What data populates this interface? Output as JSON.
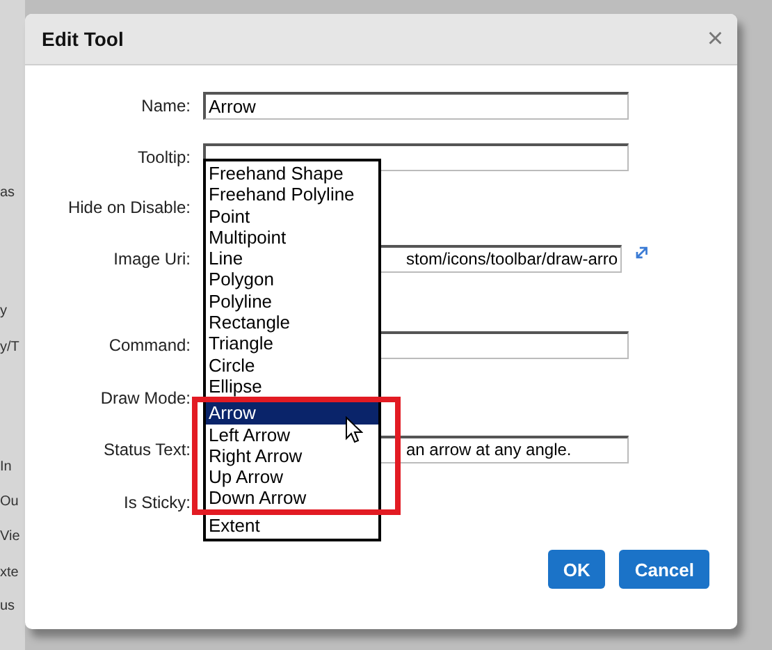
{
  "background": {
    "sidebar_fragments": [
      "as",
      "y",
      "y/T",
      "In",
      "Ou",
      "Vie",
      "xte",
      "us"
    ]
  },
  "dialog": {
    "title": "Edit Tool",
    "close": "×",
    "fields": [
      {
        "label": "Name:",
        "kind": "text",
        "value": "Arrow"
      },
      {
        "label": "Tooltip:",
        "kind": "text"
      },
      {
        "label": "Hide on Disable:",
        "kind": "covered"
      },
      {
        "label": "Image Uri:",
        "kind": "clipped_text",
        "value": "stom/icons/toolbar/draw-arro",
        "link_icon": true
      },
      {
        "label": "Command:",
        "kind": "text"
      },
      {
        "label": "Draw Mode:",
        "kind": "covered"
      },
      {
        "label": "Status Text:",
        "kind": "clipped_text",
        "value": "an arrow at any angle."
      },
      {
        "label": "Is Sticky:",
        "kind": "covered"
      }
    ],
    "dropdown": {
      "options": [
        {
          "label": "Freehand Shape",
          "selected": false,
          "highlighted": false
        },
        {
          "label": "Freehand Polyline",
          "selected": false,
          "highlighted": false
        },
        {
          "label": "Point",
          "selected": false,
          "highlighted": false
        },
        {
          "label": "Multipoint",
          "selected": false,
          "highlighted": false
        },
        {
          "label": "Line",
          "selected": false,
          "highlighted": false
        },
        {
          "label": "Polygon",
          "selected": false,
          "highlighted": false
        },
        {
          "label": "Polyline",
          "selected": false,
          "highlighted": false
        },
        {
          "label": "Rectangle",
          "selected": false,
          "highlighted": false
        },
        {
          "label": "Triangle",
          "selected": false,
          "highlighted": false
        },
        {
          "label": "Circle",
          "selected": false,
          "highlighted": false
        },
        {
          "label": "Ellipse",
          "selected": false,
          "highlighted": false
        },
        {
          "label": "Arrow",
          "selected": true,
          "highlighted": true
        },
        {
          "label": "Left Arrow",
          "selected": false,
          "highlighted": true
        },
        {
          "label": "Right Arrow",
          "selected": false,
          "highlighted": true
        },
        {
          "label": "Up Arrow",
          "selected": false,
          "highlighted": true
        },
        {
          "label": "Down Arrow",
          "selected": false,
          "highlighted": true
        },
        {
          "label": "Extent",
          "selected": false,
          "highlighted": false
        }
      ]
    },
    "buttons": [
      "OK",
      "Cancel"
    ]
  }
}
